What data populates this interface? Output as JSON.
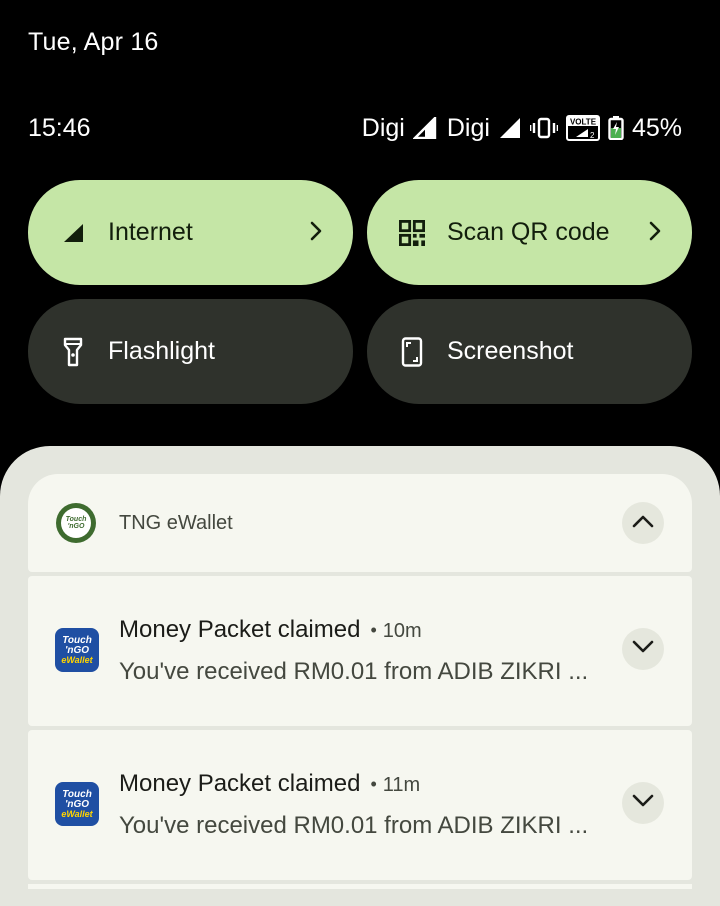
{
  "date": "Tue, Apr 16",
  "status": {
    "time": "15:46",
    "carrier1": "Digi",
    "carrier2": "Digi",
    "volte_label": "VOLTE",
    "battery": "45%"
  },
  "tiles": [
    {
      "label": "Internet",
      "icon": "signal-icon",
      "state": "on"
    },
    {
      "label": "Scan QR code",
      "icon": "qr-code-icon",
      "state": "on"
    },
    {
      "label": "Flashlight",
      "icon": "flashlight-icon",
      "state": "off"
    },
    {
      "label": "Screenshot",
      "icon": "screenshot-icon",
      "state": "off"
    }
  ],
  "notification_group": {
    "app_name": "TNG eWallet",
    "items": [
      {
        "title": "Money Packet claimed",
        "time": "10m",
        "body": "You've received RM0.01 from ADIB ZIKRI ..."
      },
      {
        "title": "Money Packet claimed",
        "time": "11m",
        "body": "You've received RM0.01 from ADIB ZIKRI ..."
      }
    ]
  },
  "tng_icon_text": {
    "line1": "Touch",
    "line2": "'nGO",
    "line3": "eWallet"
  },
  "colors": {
    "tile_on": "#c5e6a6",
    "tile_off": "#2f322c",
    "shade": "#e4e6de",
    "card": "#f6f7f0"
  }
}
